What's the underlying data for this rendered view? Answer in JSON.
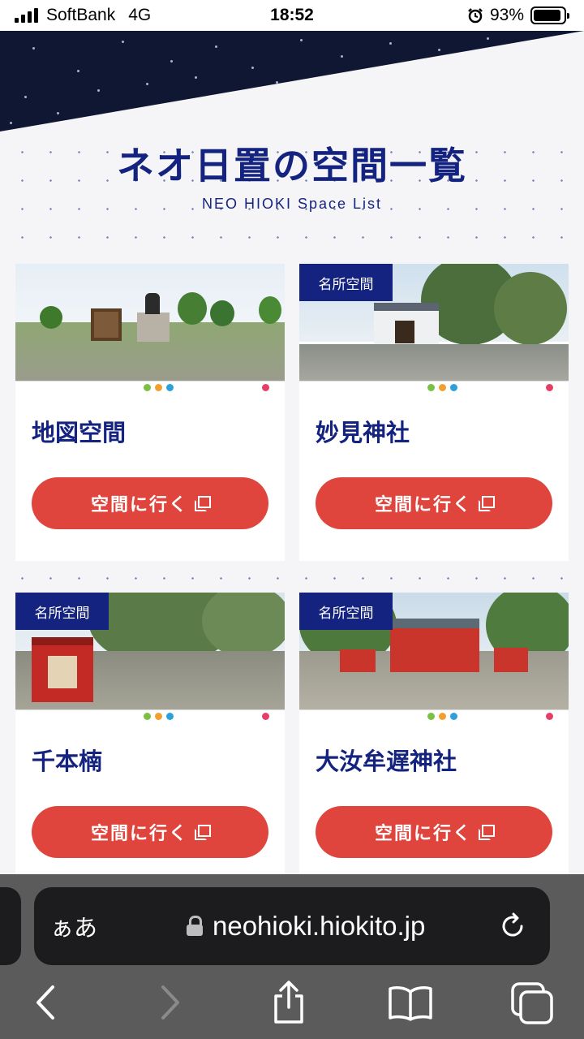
{
  "status_bar": {
    "carrier": "SoftBank",
    "network": "4G",
    "time": "18:52",
    "battery": "93%",
    "battery_level": 0.93,
    "alarm_icon": "alarm-clock-icon"
  },
  "header": {
    "title": "ネオ日置の空間一覧",
    "subtitle": "NEO HIOKI Space List"
  },
  "cards": [
    {
      "badge": "",
      "title": "地図空間",
      "button_label": "空間に行く"
    },
    {
      "badge": "名所空間",
      "title": "妙見神社",
      "button_label": "空間に行く"
    },
    {
      "badge": "名所空間",
      "title": "千本楠",
      "button_label": "空間に行く"
    },
    {
      "badge": "名所空間",
      "title": "大汝牟遅神社",
      "button_label": "空間に行く"
    }
  ],
  "browser": {
    "text_size_label": "ぁあ",
    "url": "neohioki.hiokito.jp",
    "icons": [
      "back-icon",
      "forward-icon",
      "share-icon",
      "bookmarks-icon",
      "tabs-icon",
      "reload-icon",
      "lock-icon"
    ]
  },
  "colors": {
    "navy": "#14237f",
    "button_red": "#e0453d",
    "page_bg": "#f5f5f7"
  }
}
